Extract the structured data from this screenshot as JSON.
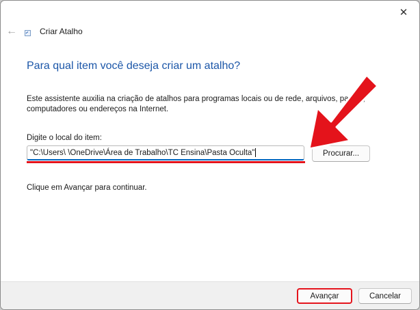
{
  "window": {
    "title": "Criar Atalho",
    "close_glyph": "✕",
    "back_glyph": "←",
    "close_icon": "close-icon",
    "back_icon": "back-arrow-icon",
    "shortcut_icon": "shortcut-icon"
  },
  "main": {
    "heading": "Para qual item você deseja criar um atalho?",
    "description": "Este assistente auxilia na criação de atalhos para programas locais ou de rede, arquivos, pastas, computadores ou endereços na Internet.",
    "field_label": "Digite o local do item:",
    "location_value": "\"C:\\Users\\        \\OneDrive\\Área de Trabalho\\TC Ensina\\Pasta Oculta\"",
    "browse_label": "Procurar...",
    "continue_text": "Clique em Avançar para continuar."
  },
  "footer": {
    "next_label": "Avançar",
    "cancel_label": "Cancelar"
  },
  "annotation": {
    "color": "#e4131b",
    "icon": "red-arrow-annotation"
  },
  "colors": {
    "heading": "#1b56a8",
    "accent": "#0067c0"
  }
}
